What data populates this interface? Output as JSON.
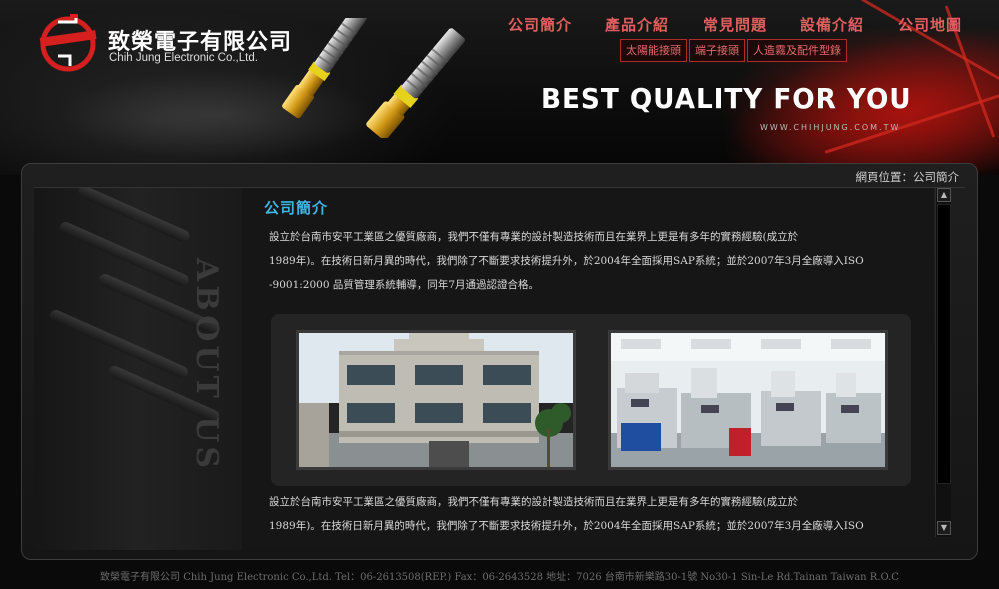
{
  "company": {
    "name_cn": "致榮電子有限公司",
    "name_en": "Chih Jung Electronic Co.,Ltd."
  },
  "nav": {
    "items": [
      {
        "label": "公司簡介"
      },
      {
        "label": "產品介紹"
      },
      {
        "label": "常見問題"
      },
      {
        "label": "設備介紹"
      },
      {
        "label": "公司地圖"
      }
    ],
    "sub_items": [
      {
        "label": "太陽能接頭"
      },
      {
        "label": "端子接頭"
      },
      {
        "label": "人造霧及配件型錄"
      }
    ]
  },
  "banner": {
    "slogan": "BEST QUALITY FOR YOU",
    "url": "WWW.CHIHJUNG.COM.TW"
  },
  "breadcrumb": "網頁位置：公司簡介",
  "sidebar": {
    "label": "ABOUT US"
  },
  "content": {
    "title": "公司簡介",
    "paragraph1_lines": [
      "設立於台南市安平工業區之優質廠商，我們不僅有專業的設計製造技術而且在業界上更是有多年的實務經驗(成立於",
      "1989年)。在技術日新月異的時代，我們除了不斷要求技術提升外，於2004年全面採用SAP系統；並於2007年3月全廠導入ISO",
      "-9001:2000 品質管理系統輔導，同年7月通過認證合格。"
    ],
    "paragraph2_lines": [
      "設立於台南市安平工業區之優質廠商，我們不僅有專業的設計製造技術而且在業界上更是有多年的實務經驗(成立於",
      "1989年)。在技術日新月異的時代，我們除了不斷要求技術提升外，於2004年全面採用SAP系統；並於2007年3月全廠導入ISO"
    ]
  },
  "footer": "致榮電子有限公司 Chih Jung Electronic Co.,Ltd.   Tel：06-2613508(REP.)    Fax：06-2643528    地址：7026 台南市新樂路30-1號  No30-1 Sin-Le Rd.Tainan Taiwan R.O.C",
  "colors": {
    "nav_red": "#e25f5f",
    "title_blue": "#3db6e6",
    "accent_red": "#b12a2a"
  }
}
